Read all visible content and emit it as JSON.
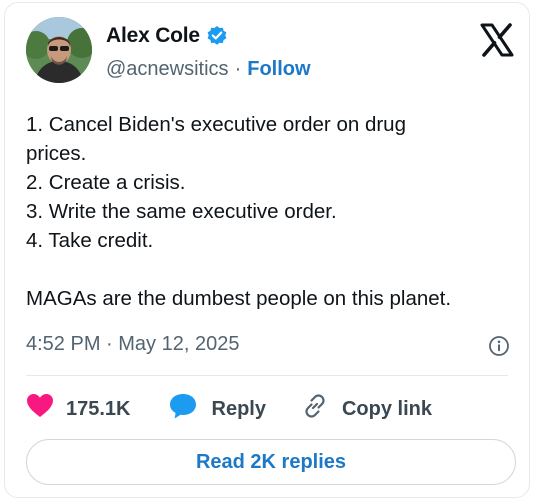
{
  "author": {
    "name": "Alex Cole",
    "handle": "@acnewsitics",
    "separator": "·",
    "follow_label": "Follow"
  },
  "icons": {
    "verified": "verified-badge-icon",
    "logo": "x-logo-icon",
    "info": "info-icon",
    "like": "heart-icon",
    "reply": "speech-bubble-icon",
    "copy": "link-icon"
  },
  "tweet": {
    "lines": [
      "1. Cancel Biden's executive order on drug",
      "prices.",
      "2. Create a crisis.",
      "3. Write the same executive order.",
      "4. Take credit."
    ],
    "closing": "MAGAs are the dumbest people on this planet."
  },
  "meta": {
    "timestamp": "4:52 PM · May 12, 2025"
  },
  "actions": {
    "like_count": "175.1K",
    "reply_label": "Reply",
    "copy_label": "Copy link"
  },
  "read_replies_label": "Read 2K replies",
  "colors": {
    "accent": "#1d79c8",
    "verified": "#1d9bf0",
    "like": "#f91880",
    "text": "#0f1419",
    "muted": "#536471"
  }
}
